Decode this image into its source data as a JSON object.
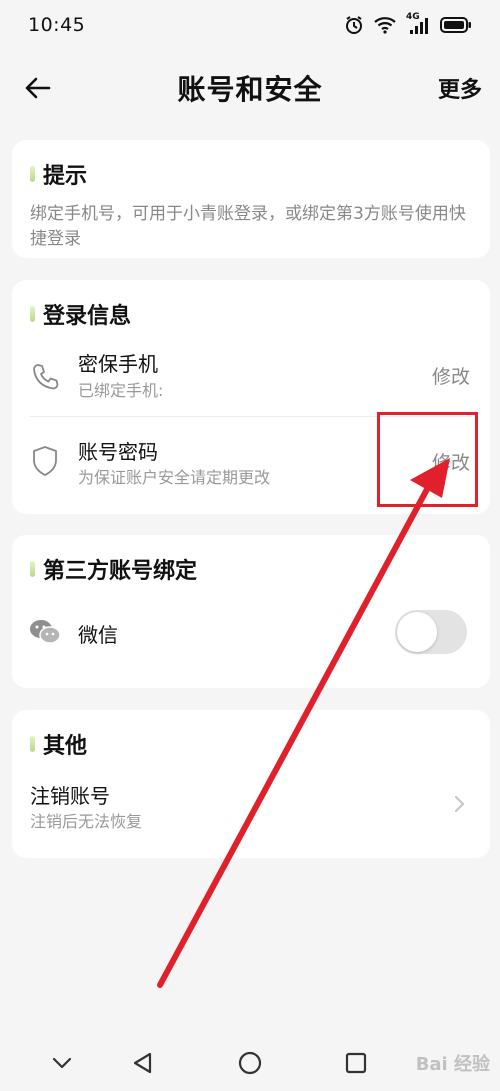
{
  "status_bar": {
    "time": "10:45",
    "network_label": "4G",
    "icons": [
      "alarm-icon",
      "wifi-icon",
      "signal-icon",
      "battery-icon"
    ]
  },
  "header": {
    "title": "账号和安全",
    "more_label": "更多",
    "back_icon": "back-arrow-icon"
  },
  "tip_card": {
    "title": "提示",
    "text": "绑定手机号，可用于小青账登录，或绑定第3方账号使用快捷登录"
  },
  "login_card": {
    "title": "登录信息",
    "rows": [
      {
        "icon": "phone-icon",
        "title": "密保手机",
        "subtitle": "已绑定手机:",
        "action": "修改"
      },
      {
        "icon": "shield-icon",
        "title": "账号密码",
        "subtitle": "为保证账户安全请定期更改",
        "action": "修改"
      }
    ]
  },
  "third_party_card": {
    "title": "第三方账号绑定",
    "rows": [
      {
        "icon": "wechat-icon",
        "title": "微信",
        "toggle_on": false
      }
    ]
  },
  "other_card": {
    "title": "其他",
    "rows": [
      {
        "title": "注销账号",
        "subtitle": "注销后无法恢复",
        "icon": "chevron-right-icon"
      }
    ]
  },
  "nav_bar": {
    "items": [
      "chevron-down-icon",
      "back-triangle-icon",
      "home-circle-icon",
      "recents-square-icon"
    ]
  },
  "watermark": {
    "text": "Bai 经验"
  },
  "colors": {
    "background": "#f5f5f5",
    "card": "#ffffff",
    "accent_bar": "#b9d98a",
    "annotation": "#e0202a",
    "muted_text": "#888888"
  }
}
